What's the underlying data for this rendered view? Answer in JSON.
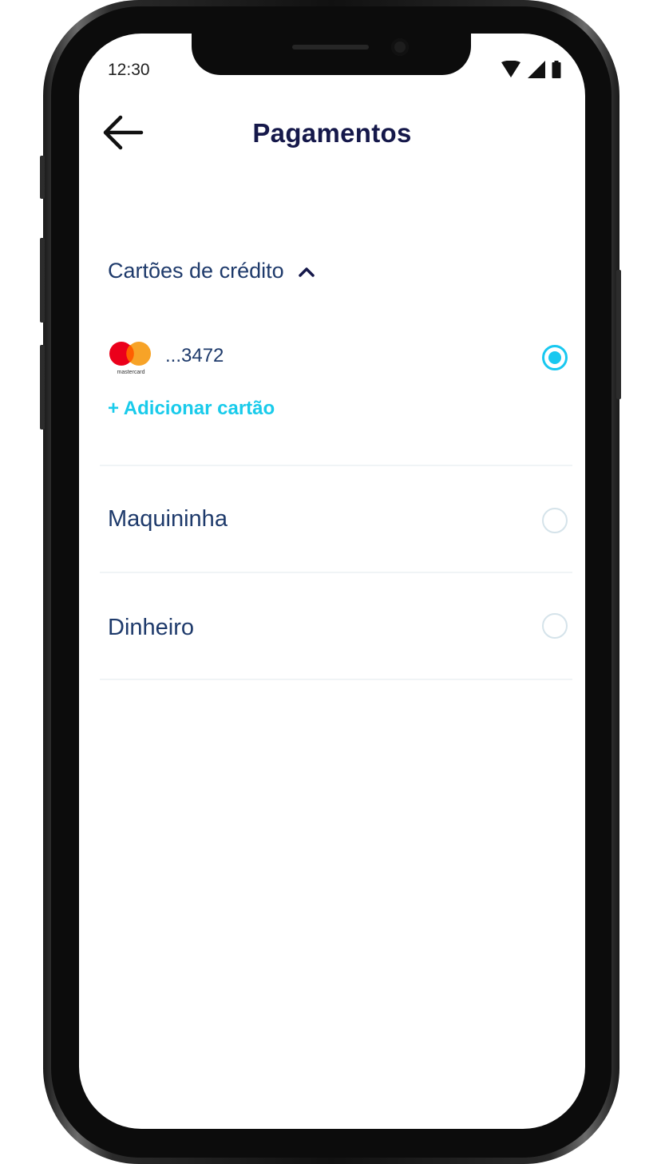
{
  "status_bar": {
    "time": "12:30"
  },
  "header": {
    "title": "Pagamentos",
    "back_icon": "arrow-left-icon"
  },
  "credit_cards_section": {
    "title": "Cartões de crédito",
    "expanded": true,
    "cards": [
      {
        "brand": "mastercard",
        "brand_label": "mastercard",
        "number": "...3472",
        "selected": true
      }
    ],
    "add_card_label": "+ Adicionar cartão"
  },
  "options": [
    {
      "label": "Maquininha",
      "selected": false
    },
    {
      "label": "Dinheiro",
      "selected": false
    }
  ],
  "colors": {
    "title": "#15184a",
    "text": "#1e3a6b",
    "accent": "#18c8f0",
    "radio_border": "#d5e3ea",
    "mastercard_red": "#eb001b",
    "mastercard_orange": "#f79e1b"
  }
}
